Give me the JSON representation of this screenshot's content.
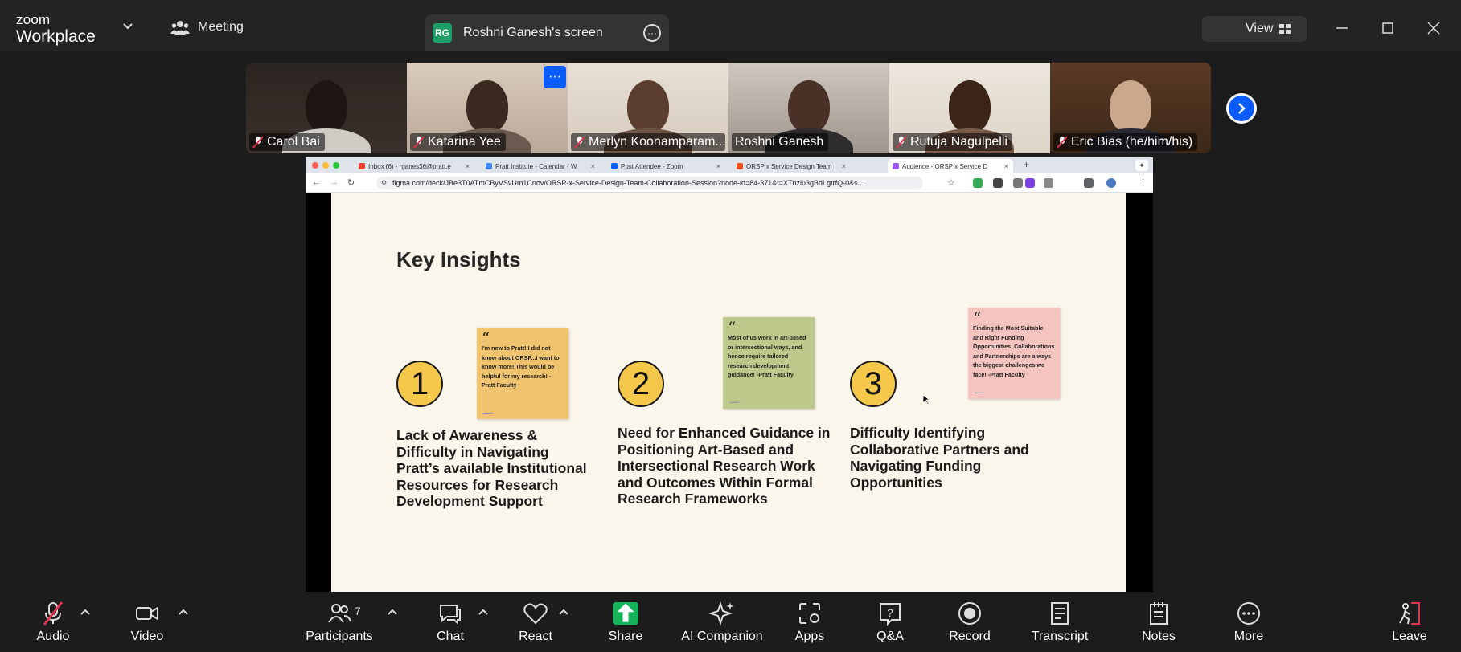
{
  "app": {
    "logo_top": "zoom",
    "logo_bottom": "Workplace",
    "meeting_label": "Meeting",
    "share_initials": "RG",
    "share_title": "Roshni Ganesh's screen",
    "view_label": "View"
  },
  "participants": [
    {
      "name": "Carol Bai",
      "muted": true
    },
    {
      "name": "Katarina Yee",
      "muted": true
    },
    {
      "name": "Merlyn Koonamparam...",
      "muted": true
    },
    {
      "name": "Roshni Ganesh",
      "muted": false,
      "active": true
    },
    {
      "name": "Rutuja Nagulpelli",
      "muted": true
    },
    {
      "name": "Eric Bias (he/him/his)",
      "muted": true
    }
  ],
  "tile_more": "···",
  "browser": {
    "tabs": [
      {
        "label": "Inbox (6) - rganes36@pratt.e"
      },
      {
        "label": "Pratt Institute - Calendar - W"
      },
      {
        "label": "Post Attendee - Zoom"
      },
      {
        "label": "ORSP x Service Design Team"
      },
      {
        "label": "Audience - ORSP x Service D"
      }
    ],
    "url": "figma.com/deck/JBe3T0ATmCByVSvUm1Cnov/ORSP-x-Service-Design-Team-Collaboration-Session?node-id=84-371&t=XTnziu3gBdLgtrfQ-0&s..."
  },
  "slide": {
    "title": "Key Insights",
    "insights": [
      {
        "number": "1",
        "text": "Lack of Awareness & Difficulty in Navigating Pratt’s available Institutional Resources for Research Development Support",
        "quote": "I'm new to Pratt! I did not know about ORSP...I want to know more! This would be helpful for my research! -Pratt Faculty",
        "note_color": "#f0c36f"
      },
      {
        "number": "2",
        "text": "Need for Enhanced Guidance in Positioning Art-Based and Intersectional Research Work and Outcomes Within Formal Research Frameworks",
        "quote": "Most of us work in art-based or intersectional ways, and hence require tailored research development guidance! -Pratt Faculty",
        "note_color": "#bdc98a"
      },
      {
        "number": "3",
        "text": "Difficulty Identifying Collaborative Partners and Navigating Funding Opportunities",
        "quote": "Finding the Most Suitable and Right Funding Opportunities, Collaborations and Partnerships are always the biggest challenges we face! -Pratt Faculty",
        "note_color": "#f6c4c0"
      }
    ]
  },
  "toolbar": {
    "audio": "Audio",
    "video": "Video",
    "participants": "Participants",
    "participants_count": "7",
    "chat": "Chat",
    "react": "React",
    "share": "Share",
    "ai": "AI Companion",
    "apps": "Apps",
    "qa": "Q&A",
    "record": "Record",
    "transcript": "Transcript",
    "notes": "Notes",
    "more": "More",
    "leave": "Leave"
  }
}
